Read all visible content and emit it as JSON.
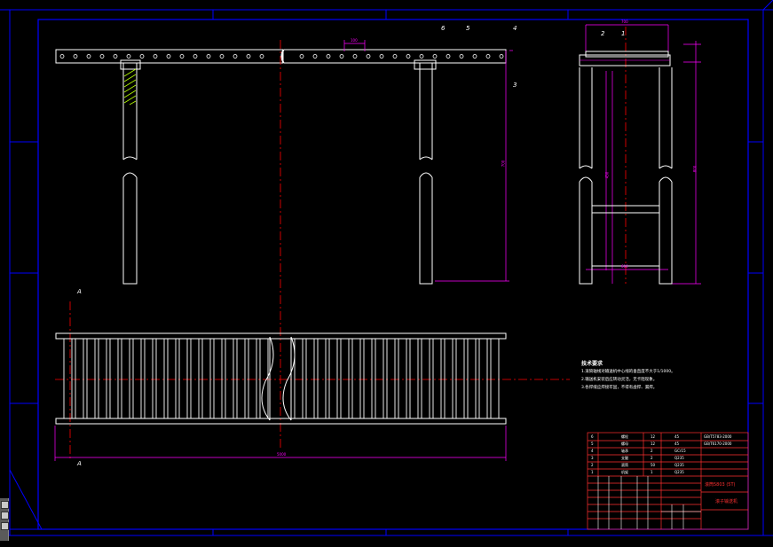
{
  "drawing": {
    "colors": {
      "background": "#000000",
      "frame": "#0000ff",
      "outline": "#ffffff",
      "centerline": "#ff0000",
      "dimension": "#ff00ff",
      "hatch": "#b6ff00",
      "table_lines": "#ff0000"
    },
    "part_labels": [
      "6",
      "5",
      "4",
      "3",
      "2",
      "1"
    ],
    "section_labels": [
      "A",
      "A"
    ],
    "dimensions": {
      "pitch": "100",
      "height_front": "700",
      "width_top": "700",
      "height_side": "800",
      "height_side_inner": "450",
      "width_side_bottom": "600",
      "length_total": "5000"
    },
    "technical_notes": {
      "title": "技术要求",
      "lines": [
        "1.滚筒轴线对输送机中心线的垂直度不大于1/1000。",
        "2.输送机安装后应转动灵活，无卡阻现象。",
        "3.各焊缝应焊接牢固，不得有虚焊、漏焊。"
      ]
    },
    "title_block": {
      "drawing_no": "滚筒5803 (5T)",
      "name": "滚子输送机",
      "std_1": "GB/T5783-2000",
      "std_2": "GB/T6170-2000",
      "rows": [
        {
          "no": "6",
          "name": "螺栓",
          "qty": "12",
          "material": "45"
        },
        {
          "no": "5",
          "name": "螺母",
          "qty": "12",
          "material": "45"
        },
        {
          "no": "4",
          "name": "轴承",
          "qty": "2",
          "material": "GCr15"
        },
        {
          "no": "3",
          "name": "支腿",
          "qty": "2",
          "material": "Q235"
        },
        {
          "no": "2",
          "name": "滚筒",
          "qty": "50",
          "material": "Q235"
        },
        {
          "no": "1",
          "name": "机架",
          "qty": "1",
          "material": "Q235"
        }
      ]
    }
  }
}
